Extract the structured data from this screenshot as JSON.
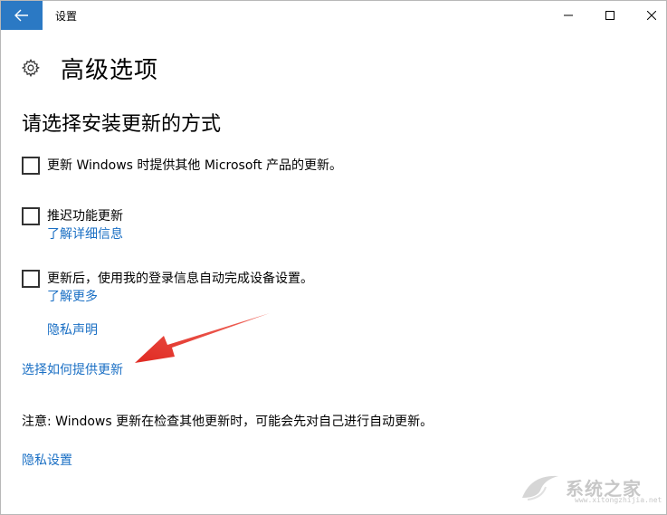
{
  "window": {
    "title": "设置"
  },
  "page": {
    "title": "高级选项",
    "section_title": "请选择安装更新的方式"
  },
  "options": [
    {
      "label": "更新 Windows 时提供其他 Microsoft 产品的更新。",
      "checked": false
    },
    {
      "label": "推迟功能更新",
      "checked": false,
      "link": "了解详细信息"
    },
    {
      "label": "更新后，使用我的登录信息自动完成设备设置。",
      "checked": false,
      "link": "了解更多"
    }
  ],
  "links": {
    "privacy_statement": "隐私声明",
    "choose_delivery": "选择如何提供更新",
    "privacy_settings": "隐私设置"
  },
  "note": "注意: Windows 更新在检查其他更新时，可能会先对自己进行自动更新。",
  "watermark": {
    "text": "系统之家",
    "url": "www.xitongzhijia.net"
  },
  "colors": {
    "accent": "#2b79c4",
    "link": "#1a6fc4",
    "annotation_arrow": "#e8392f"
  },
  "icons": {
    "back": "arrow-left-icon",
    "settings": "gear-icon",
    "minimize": "minimize-icon",
    "maximize": "maximize-icon",
    "close": "close-icon"
  }
}
